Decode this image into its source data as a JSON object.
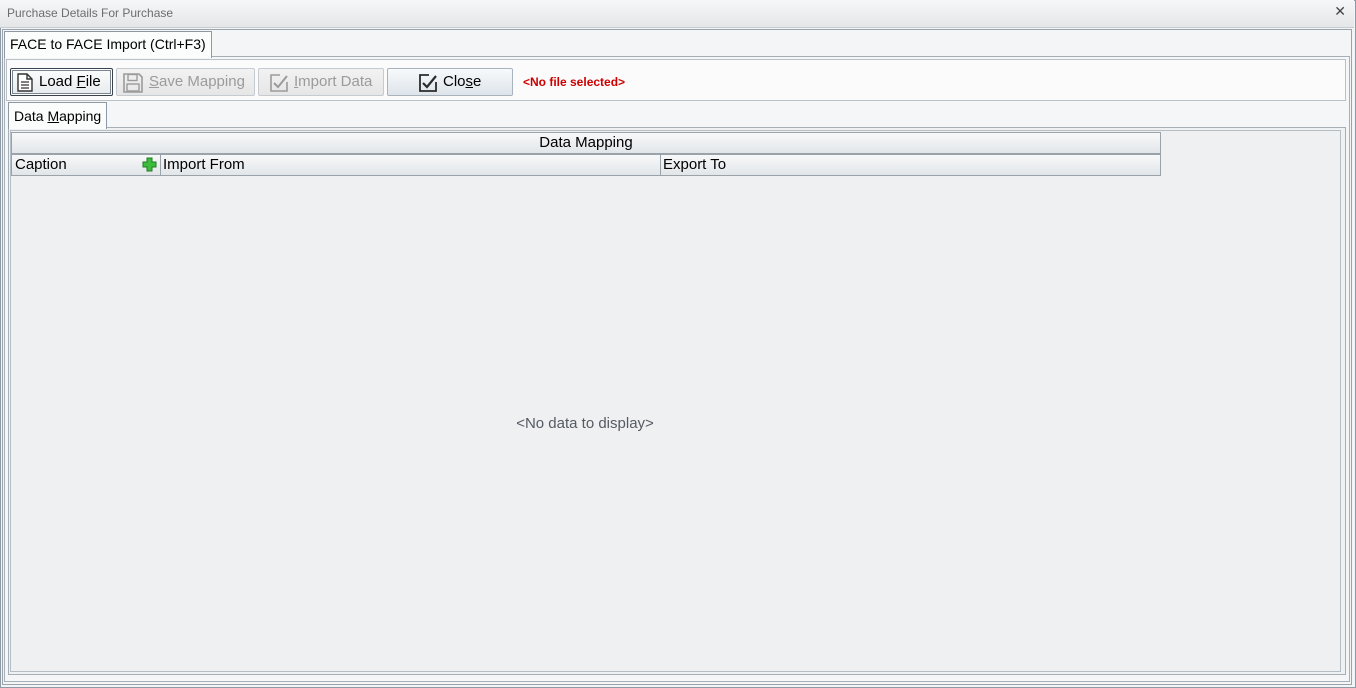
{
  "window": {
    "title": "Purchase Details For Purchase",
    "close_glyph": "✕"
  },
  "tabs": [
    {
      "label": "FACE to FACE Import (Ctrl+F3)",
      "active": true
    }
  ],
  "toolbar": {
    "load_file": {
      "label": "Load File",
      "mnemonic": "F",
      "icon": "document-icon",
      "enabled": true
    },
    "save_mapping": {
      "label": "Save Mapping",
      "mnemonic": "S",
      "icon": "floppy-disk-icon",
      "enabled": false
    },
    "import_data": {
      "label": "Import Data",
      "mnemonic": "I",
      "icon": "import-check-icon",
      "enabled": false
    },
    "close": {
      "label": "Close",
      "mnemonic": "s",
      "icon": "close-check-icon",
      "enabled": true
    },
    "status": "<No file selected>"
  },
  "sub_tabs": [
    {
      "label": "Data Mapping",
      "mnemonic": "M",
      "active": true
    }
  ],
  "grid": {
    "band_header": "Data Mapping",
    "columns": [
      "Caption",
      "Import From",
      "Export To"
    ],
    "add_icon": "plus-icon",
    "rows": [],
    "empty_message": "<No data to display>"
  },
  "colors": {
    "status_text": "#cc0000",
    "add_icon": "#2fa52f"
  }
}
